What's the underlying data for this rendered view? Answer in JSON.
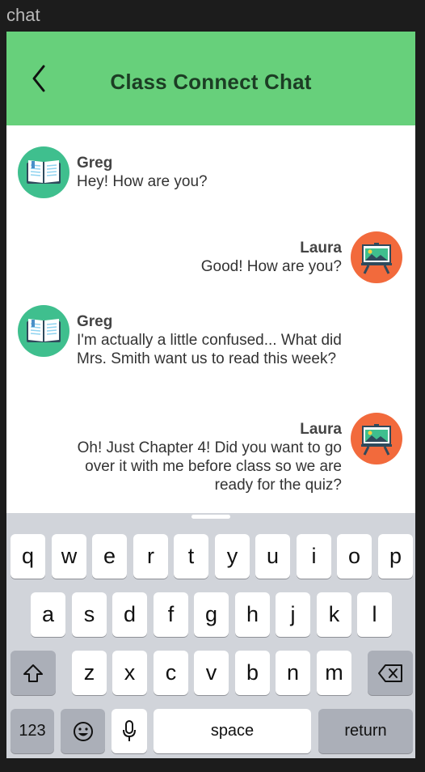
{
  "window": {
    "title": "chat"
  },
  "header": {
    "title": "Class Connect Chat",
    "back_icon": "chevron-left-icon",
    "color": "#67d07b"
  },
  "messages": [
    {
      "sender": "Greg",
      "side": "left",
      "avatar": "book-icon",
      "text": "Hey! How are you?"
    },
    {
      "sender": "Laura",
      "side": "right",
      "avatar": "easel-icon",
      "text": "Good! How are you?"
    },
    {
      "sender": "Greg",
      "side": "left",
      "avatar": "book-icon",
      "text": "I'm actually a little confused... What did Mrs. Smith want us to read this week?"
    },
    {
      "sender": "Laura",
      "side": "right",
      "avatar": "easel-icon",
      "text": "Oh! Just Chapter 4! Did you want to go over it with me before class so we are ready for the quiz?"
    }
  ],
  "keyboard": {
    "row1": [
      "q",
      "w",
      "e",
      "r",
      "t",
      "y",
      "u",
      "i",
      "o",
      "p"
    ],
    "row2": [
      "a",
      "s",
      "d",
      "f",
      "g",
      "h",
      "j",
      "k",
      "l"
    ],
    "row3": [
      "z",
      "x",
      "c",
      "v",
      "b",
      "n",
      "m"
    ],
    "shift_icon": "shift-icon",
    "delete_icon": "backspace-icon",
    "numbers_label": "123",
    "emoji_icon": "emoji-icon",
    "mic_icon": "microphone-icon",
    "space_label": "space",
    "return_label": "return"
  }
}
